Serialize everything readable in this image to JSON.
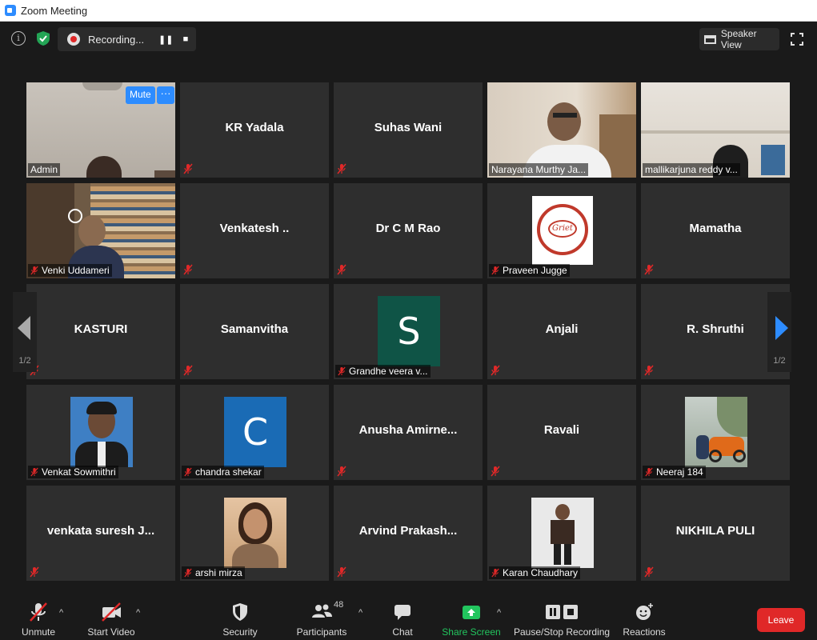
{
  "window": {
    "title": "Zoom Meeting"
  },
  "topbar": {
    "recording_label": "Recording...",
    "speaker_view_label": "Speaker View"
  },
  "mute_label": "Mute",
  "more_label": "···",
  "pager": {
    "left_page": "1/2",
    "right_page": "1/2"
  },
  "tiles": [
    {
      "name": "Admin",
      "type": "video"
    },
    {
      "name": "KR Yadala",
      "type": "name"
    },
    {
      "name": "Suhas Wani",
      "type": "name"
    },
    {
      "name": "Narayana Murthy Ja...",
      "type": "video",
      "active": true
    },
    {
      "name": "mallikarjuna reddy v...",
      "type": "video"
    },
    {
      "name": "Venki Uddameri",
      "type": "video"
    },
    {
      "name": "Venkatesh ..",
      "type": "name"
    },
    {
      "name": "Dr C M Rao",
      "type": "name"
    },
    {
      "name": "Praveen Jugge",
      "type": "logo",
      "logo_text": "Griet"
    },
    {
      "name": "Mamatha",
      "type": "name"
    },
    {
      "name": "KASTURI",
      "type": "name"
    },
    {
      "name": "Samanvitha",
      "type": "name"
    },
    {
      "name": "Grandhe veera v...",
      "type": "letter",
      "letter": "S",
      "color": "#0f5446"
    },
    {
      "name": "Anjali",
      "type": "name"
    },
    {
      "name": "R. Shruthi",
      "type": "name"
    },
    {
      "name": "Venkat Sowmithri",
      "type": "photo"
    },
    {
      "name": "chandra shekar",
      "type": "letter",
      "letter": "C",
      "color": "#1a6bb5"
    },
    {
      "name": "Anusha  Amirne...",
      "type": "name"
    },
    {
      "name": "Ravali",
      "type": "name"
    },
    {
      "name": "Neeraj 184",
      "type": "photo"
    },
    {
      "name": "venkata suresh J...",
      "type": "name"
    },
    {
      "name": "arshi mirza",
      "type": "photo"
    },
    {
      "name": "Arvind  Prakash...",
      "type": "name"
    },
    {
      "name": "Karan Chaudhary",
      "type": "photo"
    },
    {
      "name": "NIKHILA PULI",
      "type": "name"
    }
  ],
  "toolbar": {
    "unmute": "Unmute",
    "start_video": "Start Video",
    "security": "Security",
    "participants": "Participants",
    "participants_count": "48",
    "chat": "Chat",
    "share_screen": "Share Screen",
    "recording": "Pause/Stop Recording",
    "reactions": "Reactions",
    "leave": "Leave"
  },
  "colors": {
    "accent": "#2d8cff",
    "active_speaker": "#c8e45a",
    "leave": "#e02828",
    "share": "#22c55e",
    "mic_off": "#e02828"
  }
}
